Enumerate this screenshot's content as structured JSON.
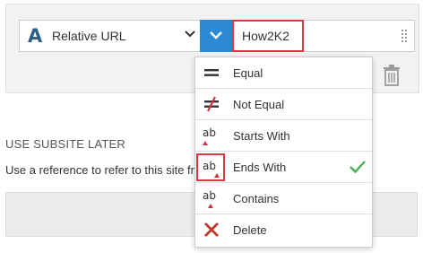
{
  "filter": {
    "field_label": "Relative URL",
    "field_icon": "text-field-icon",
    "operator_icon": "chevron-down-icon",
    "value": "How2K2"
  },
  "section": {
    "title": "USE SUBSITE LATER",
    "description": "Use a reference to refer to this site fro"
  },
  "operator_menu": {
    "items": [
      {
        "label": "Equal",
        "icon": "equal-icon"
      },
      {
        "label": "Not Equal",
        "icon": "not-equal-icon"
      },
      {
        "label": "Starts With",
        "icon": "starts-with-icon"
      },
      {
        "label": "Ends With",
        "icon": "ends-with-icon",
        "selected": true
      },
      {
        "label": "Contains",
        "icon": "contains-icon"
      },
      {
        "label": "Delete",
        "icon": "delete-x-icon"
      }
    ],
    "icon_glyph": "ab"
  },
  "colors": {
    "accent_blue": "#2c8ad4",
    "highlight_red": "#e0353f",
    "check_green": "#4caf50",
    "delete_red": "#c0392b"
  }
}
